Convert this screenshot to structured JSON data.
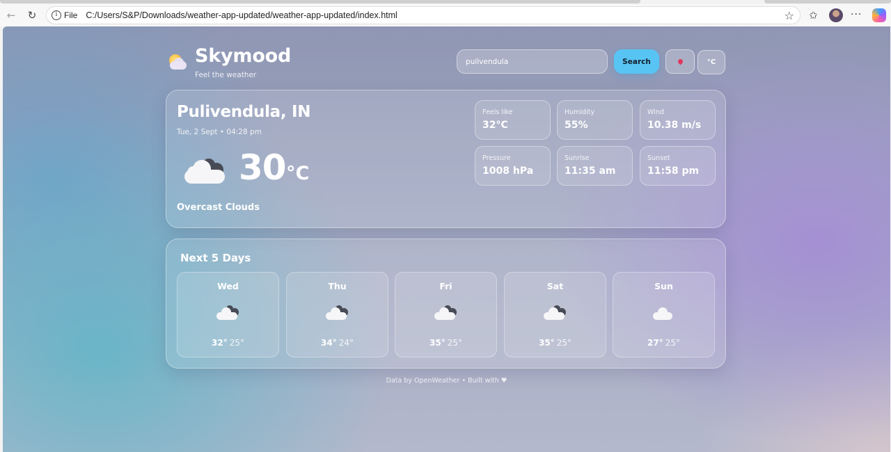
{
  "browser": {
    "scheme_label": "File",
    "url": "C:/Users/S&P/Downloads/weather-app-updated/weather-app-updated/index.html"
  },
  "app": {
    "title": "Skymood",
    "tagline": "Feel the weather"
  },
  "search": {
    "value": "pulivendula",
    "button_label": "Search",
    "unit_button_label": "°C"
  },
  "current": {
    "city": "Pulivendula, IN",
    "datetime": "Tue, 2 Sept • 04:28 pm",
    "temp": "30",
    "unit": "°C",
    "condition": "Overcast Clouds",
    "icon": "overcast-clouds-icon",
    "stats": [
      {
        "label": "Feels like",
        "value": "32°C"
      },
      {
        "label": "Humidity",
        "value": "55%"
      },
      {
        "label": "Wind",
        "value": "10.38 m/s"
      },
      {
        "label": "Pressure",
        "value": "1008 hPa"
      },
      {
        "label": "Sunrise",
        "value": "11:35 am"
      },
      {
        "label": "Sunset",
        "value": "11:58 pm"
      }
    ]
  },
  "forecast": {
    "title": "Next 5 Days",
    "days": [
      {
        "name": "Wed",
        "hi": "32°",
        "lo": "25°",
        "icon": "overcast-clouds-icon"
      },
      {
        "name": "Thu",
        "hi": "34°",
        "lo": "24°",
        "icon": "overcast-clouds-icon"
      },
      {
        "name": "Fri",
        "hi": "35°",
        "lo": "25°",
        "icon": "overcast-clouds-icon"
      },
      {
        "name": "Sat",
        "hi": "35°",
        "lo": "25°",
        "icon": "overcast-clouds-icon"
      },
      {
        "name": "Sun",
        "hi": "27°",
        "lo": "25°",
        "icon": "cloud-icon"
      }
    ]
  },
  "footer": "Data by OpenWeather • Built with ♥",
  "colors": {
    "accent": "#58c4f4",
    "location_pin": "#e2365a"
  }
}
